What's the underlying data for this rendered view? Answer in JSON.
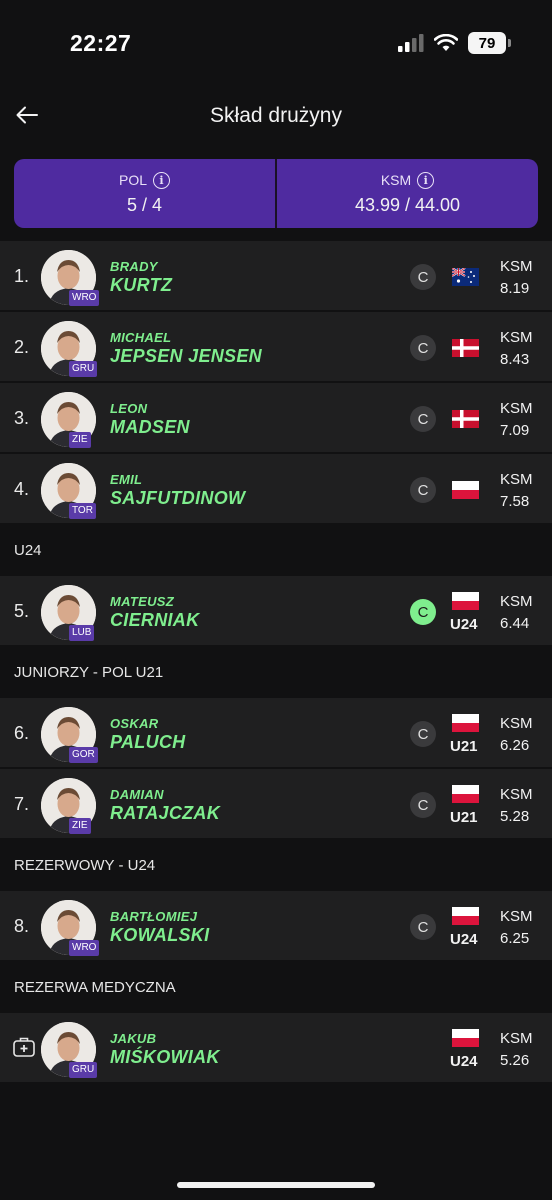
{
  "status_bar": {
    "time": "22:27",
    "battery": "79"
  },
  "header": {
    "title": "Skład drużyny"
  },
  "summary": [
    {
      "label": "POL",
      "value": "5 / 4"
    },
    {
      "label": "KSM",
      "value": "43.99 / 44.00"
    }
  ],
  "colors": {
    "accent": "#7fee8e",
    "card": "#4f2ba0",
    "row": "#1f1f20",
    "tag": "#5a3ba8"
  },
  "rows": [
    {
      "kind": "player",
      "rank": "1.",
      "first": "BRADY",
      "last": "KURTZ",
      "team": "WRO",
      "flag": "australia",
      "age_tag": "",
      "captain": "C",
      "captain_active": false,
      "ksm_label": "KSM",
      "ksm": "8.19"
    },
    {
      "kind": "player",
      "rank": "2.",
      "first": "MICHAEL",
      "last": "JEPSEN JENSEN",
      "team": "GRU",
      "flag": "denmark",
      "age_tag": "",
      "captain": "C",
      "captain_active": false,
      "ksm_label": "KSM",
      "ksm": "8.43"
    },
    {
      "kind": "player",
      "rank": "3.",
      "first": "LEON",
      "last": "MADSEN",
      "team": "ZIE",
      "flag": "denmark",
      "age_tag": "",
      "captain": "C",
      "captain_active": false,
      "ksm_label": "KSM",
      "ksm": "7.09"
    },
    {
      "kind": "player",
      "rank": "4.",
      "first": "EMIL",
      "last": "SAJFUTDINOW",
      "team": "TOR",
      "flag": "poland",
      "age_tag": "",
      "captain": "C",
      "captain_active": false,
      "ksm_label": "KSM",
      "ksm": "7.58"
    },
    {
      "kind": "section",
      "label": "U24"
    },
    {
      "kind": "player",
      "rank": "5.",
      "first": "MATEUSZ",
      "last": "CIERNIAK",
      "team": "LUB",
      "flag": "poland",
      "age_tag": "U24",
      "captain": "C",
      "captain_active": true,
      "ksm_label": "KSM",
      "ksm": "6.44"
    },
    {
      "kind": "section",
      "label": "JUNIORZY - POL U21"
    },
    {
      "kind": "player",
      "rank": "6.",
      "first": "OSKAR",
      "last": "PALUCH",
      "team": "GOR",
      "flag": "poland",
      "age_tag": "U21",
      "captain": "C",
      "captain_active": false,
      "ksm_label": "KSM",
      "ksm": "6.26"
    },
    {
      "kind": "player",
      "rank": "7.",
      "first": "DAMIAN",
      "last": "RATAJCZAK",
      "team": "ZIE",
      "flag": "poland",
      "age_tag": "U21",
      "captain": "C",
      "captain_active": false,
      "ksm_label": "KSM",
      "ksm": "5.28"
    },
    {
      "kind": "section",
      "label": "REZERWOWY - U24"
    },
    {
      "kind": "player",
      "rank": "8.",
      "first": "BARTŁOMIEJ",
      "last": "KOWALSKI",
      "team": "WRO",
      "flag": "poland",
      "age_tag": "U24",
      "captain": "C",
      "captain_active": false,
      "ksm_label": "KSM",
      "ksm": "6.25"
    },
    {
      "kind": "section",
      "label": "REZERWA MEDYCZNA"
    },
    {
      "kind": "player",
      "rank": "",
      "medical": true,
      "first": "JAKUB",
      "last": "MIŚKOWIAK",
      "team": "GRU",
      "flag": "poland",
      "age_tag": "U24",
      "captain": "",
      "captain_active": false,
      "ksm_label": "KSM",
      "ksm": "5.26"
    }
  ]
}
